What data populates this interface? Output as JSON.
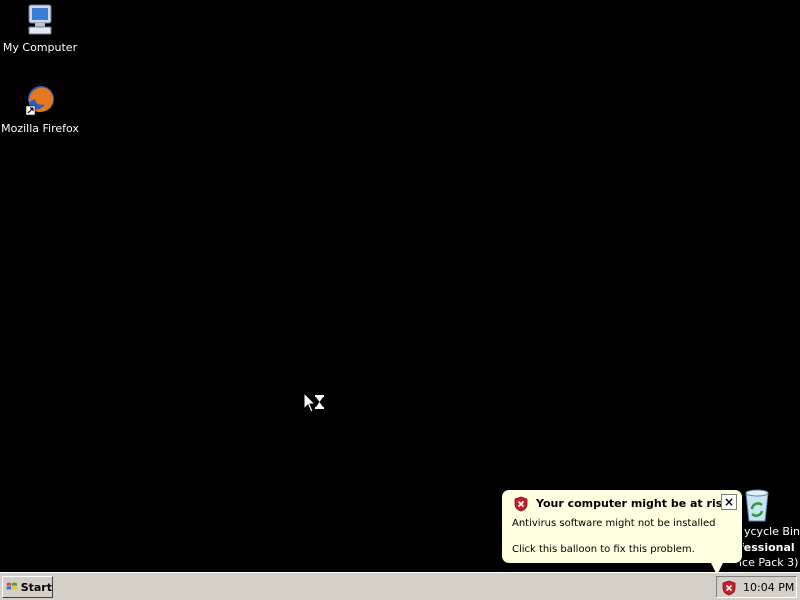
{
  "desktop": {
    "icons": [
      {
        "label": "My Computer",
        "icon": "my-computer-icon"
      },
      {
        "label": "Mozilla Firefox",
        "icon": "firefox-icon"
      },
      {
        "label": "ycycle Bin",
        "icon": "recycle-bin-icon"
      }
    ],
    "watermark": {
      "line1": "fessional",
      "line2": "ice Pack 3)"
    }
  },
  "balloon": {
    "title": "Your computer might be at risk",
    "line1": "Antivirus software might not be installed",
    "line2": "Click this balloon to fix this problem.",
    "close_label": "×",
    "icon": "security-shield-icon",
    "background": "#ffffe1"
  },
  "taskbar": {
    "start_label": "Start",
    "clock": "10:04 PM",
    "tray_icon": "security-shield-icon",
    "background": "#d4d0c8"
  }
}
